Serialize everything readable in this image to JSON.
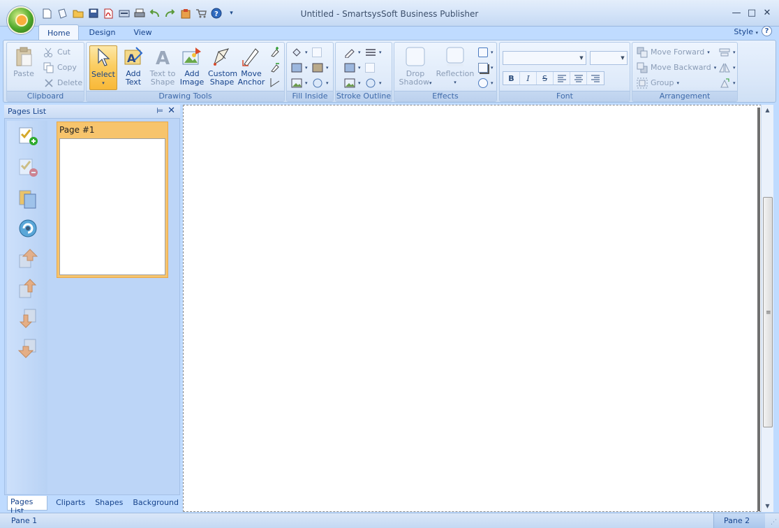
{
  "window": {
    "title": "Untitled - SmartsysSoft Business Publisher",
    "controls": [
      "minimize-icon",
      "maximize-icon",
      "close-icon"
    ]
  },
  "quick_access": [
    "new-icon",
    "open-template-icon",
    "open-icon",
    "save-icon",
    "pdf-icon",
    "scan-icon",
    "print-icon",
    "undo-icon",
    "redo-icon",
    "paste-icon",
    "cart-icon",
    "help-icon",
    "customize-icon"
  ],
  "ribbon": {
    "tabs": [
      "Home",
      "Design",
      "View"
    ],
    "active_tab": "Home",
    "style_label": "Style",
    "clipboard": {
      "label": "Clipboard",
      "paste": "Paste",
      "cut": "Cut",
      "copy": "Copy",
      "delete": "Delete"
    },
    "drawing_tools": {
      "label": "Drawing Tools",
      "select": "Select",
      "add_text": [
        "Add",
        "Text"
      ],
      "text_to_shape": [
        "Text to",
        "Shape"
      ],
      "add_image": [
        "Add",
        "Image"
      ],
      "custom_shape": [
        "Custom",
        "Shape"
      ],
      "move_anchor": [
        "Move",
        "Anchor"
      ]
    },
    "fill_inside": {
      "label": "Fill Inside"
    },
    "stroke_outline": {
      "label": "Stroke Outline"
    },
    "effects": {
      "label": "Effects",
      "drop_shadow": [
        "Drop",
        "Shadow"
      ],
      "reflection": "Reflection"
    },
    "font": {
      "label": "Font",
      "family_value": "",
      "size_value": "",
      "format_buttons": [
        "B",
        "I",
        "S",
        "left",
        "center",
        "right"
      ]
    },
    "arrangement": {
      "label": "Arrangement",
      "move_forward": "Move Forward",
      "move_backward": "Move Backward",
      "group": "Group"
    }
  },
  "pages_pane": {
    "title": "Pages List",
    "page_title": "Page #1",
    "tabs": [
      "Pages List",
      "Cliparts",
      "Shapes",
      "Background"
    ],
    "active_tab": "Pages List",
    "tools": [
      "add-page-icon",
      "remove-page-icon",
      "duplicate-page-icon",
      "refresh-page-icon",
      "move-first-icon",
      "move-up-icon",
      "move-down-icon",
      "move-last-icon"
    ]
  },
  "status": {
    "left": "Pane 1",
    "right": "Pane 2"
  },
  "colors": {
    "ribbon_bg": "#dbe8f9",
    "selected_button": "#fbce63",
    "page_thumb": "#f7c46c",
    "text": "#15428b"
  }
}
